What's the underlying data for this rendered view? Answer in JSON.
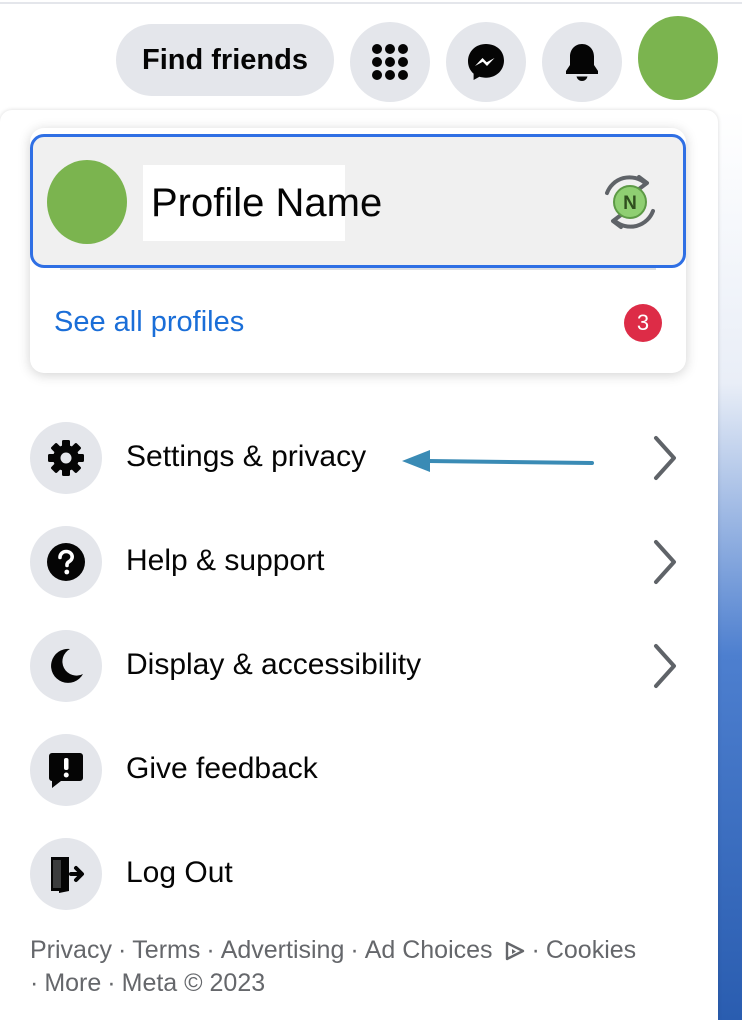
{
  "header": {
    "find_friends_label": "Find friends",
    "icons": [
      "menu-grid-icon",
      "messenger-icon",
      "bell-icon",
      "avatar"
    ]
  },
  "profile": {
    "name": "Profile Name",
    "switch_badge_letter": "N",
    "see_all_label": "See all profiles",
    "notification_count": "3"
  },
  "menu": {
    "items": [
      {
        "label": "Settings & privacy",
        "icon": "gear-icon",
        "has_chevron": true
      },
      {
        "label": "Help & support",
        "icon": "question-icon",
        "has_chevron": true
      },
      {
        "label": "Display & accessibility",
        "icon": "moon-icon",
        "has_chevron": true
      },
      {
        "label": "Give feedback",
        "icon": "feedback-icon",
        "has_chevron": false
      },
      {
        "label": "Log Out",
        "icon": "logout-icon",
        "has_chevron": false
      }
    ]
  },
  "footer": {
    "links": [
      "Privacy",
      "Terms",
      "Advertising",
      "Ad Choices",
      "Cookies",
      "More"
    ],
    "copyright": "Meta © 2023"
  },
  "colors": {
    "accent_blue": "#1a6ed8",
    "highlight_border": "#2f6fe4",
    "badge_red": "#dd2c47",
    "avatar_green": "#7bb44f",
    "icon_bg": "#e4e6eb",
    "annotation_arrow": "#3a8bb5"
  }
}
